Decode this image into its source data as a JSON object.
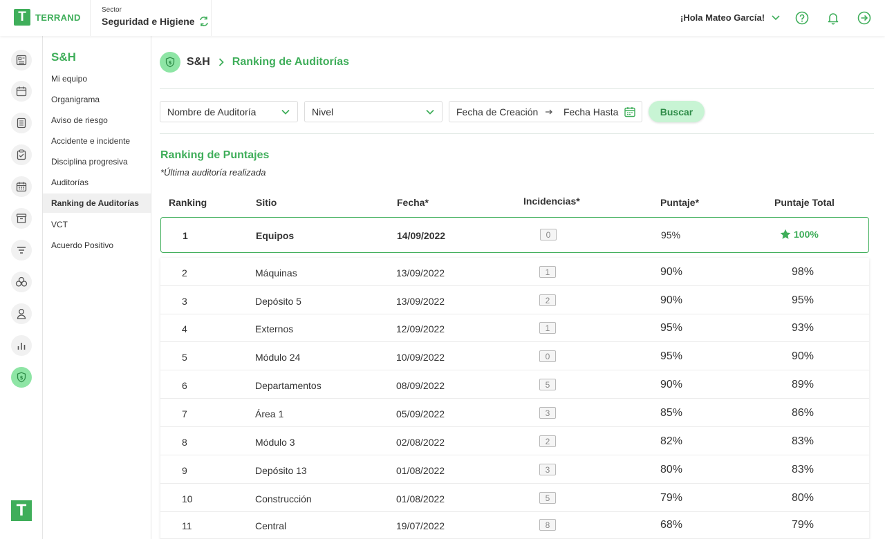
{
  "brand": {
    "name": "TERRAND",
    "mark": "T"
  },
  "sector": {
    "label": "Sector",
    "value": "Seguridad e Higiene"
  },
  "user": {
    "greeting": "¡Hola Mateo García!"
  },
  "sidebar": {
    "title": "S&H",
    "items": [
      {
        "label": "Mi equipo"
      },
      {
        "label": "Organigrama"
      },
      {
        "label": "Aviso de riesgo"
      },
      {
        "label": "Accidente e incidente"
      },
      {
        "label": "Disciplina progresiva"
      },
      {
        "label": "Auditorías"
      },
      {
        "label": "Ranking de Auditorías"
      },
      {
        "label": "VCT"
      },
      {
        "label": "Acuerdo Positivo"
      }
    ]
  },
  "breadcrumb": {
    "root": "S&H",
    "current": "Ranking de Auditorías"
  },
  "filters": {
    "audit_name": "Nombre de Auditoría",
    "level": "Nivel",
    "date_from": "Fecha de Creación",
    "date_to": "Fecha Hasta",
    "search_label": "Buscar"
  },
  "ranking": {
    "title": "Ranking de Puntajes",
    "note": "*Última auditoría realizada",
    "columns": [
      "Ranking",
      "Sitio",
      "Fecha*",
      "Incidencias*",
      "Puntaje*",
      "Puntaje Total"
    ],
    "top": {
      "rank": "1",
      "site": "Equipos",
      "date": "14/09/2022",
      "incidents": "0",
      "score": "95%",
      "total": "100%"
    },
    "rows": [
      {
        "rank": "2",
        "site": "Máquinas",
        "date": "13/09/2022",
        "incidents": "1",
        "score": "90%",
        "total": "98%"
      },
      {
        "rank": "3",
        "site": "Depósito 5",
        "date": "13/09/2022",
        "incidents": "2",
        "score": "90%",
        "total": "95%"
      },
      {
        "rank": "4",
        "site": "Externos",
        "date": "12/09/2022",
        "incidents": "1",
        "score": "95%",
        "total": "93%"
      },
      {
        "rank": "5",
        "site": "Módulo 24",
        "date": "10/09/2022",
        "incidents": "0",
        "score": "95%",
        "total": "90%"
      },
      {
        "rank": "6",
        "site": "Departamentos",
        "date": "08/09/2022",
        "incidents": "5",
        "score": "90%",
        "total": "89%"
      },
      {
        "rank": "7",
        "site": "Área 1",
        "date": "05/09/2022",
        "incidents": "3",
        "score": "85%",
        "total": "86%"
      },
      {
        "rank": "8",
        "site": "Módulo 3",
        "date": "02/08/2022",
        "incidents": "2",
        "score": "82%",
        "total": "83%"
      },
      {
        "rank": "9",
        "site": "Depósito 13",
        "date": "01/08/2022",
        "incidents": "3",
        "score": "80%",
        "total": "83%"
      },
      {
        "rank": "10",
        "site": "Construcción",
        "date": "01/08/2022",
        "incidents": "5",
        "score": "79%",
        "total": "80%"
      },
      {
        "rank": "11",
        "site": "Central",
        "date": "19/07/2022",
        "incidents": "8",
        "score": "68%",
        "total": "79%"
      }
    ]
  },
  "colors": {
    "accent": "#3fae5a",
    "accent_light": "#8ee5a5",
    "button_bg": "#c8f4d4"
  },
  "icons": {
    "rail": [
      "dashboard-icon",
      "calendar-icon",
      "list-icon",
      "clipboard-check-icon",
      "calendar-grid-icon",
      "archive-icon",
      "filter-lines-icon",
      "group-icon",
      "person-icon",
      "bar-chart-icon",
      "shield-icon"
    ],
    "top": [
      "refresh-icon",
      "chevron-down-icon",
      "help-icon",
      "bell-icon",
      "logout-icon"
    ]
  }
}
